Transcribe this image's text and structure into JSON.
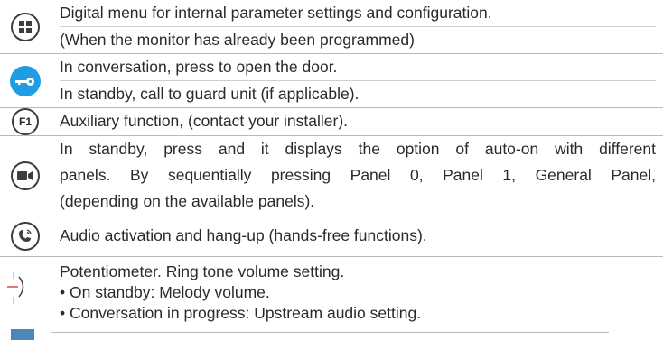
{
  "rows": [
    {
      "icon": "menu-grid-icon",
      "lines": [
        "Digital menu for internal parameter settings and configuration.",
        "(When the monitor has already been programmed)"
      ]
    },
    {
      "icon": "door-key-icon",
      "lines": [
        "In conversation, press to open the door.",
        "In standby, call to guard unit (if applicable)."
      ]
    },
    {
      "icon": "f1-icon",
      "icon_text": "F1",
      "lines": [
        "Auxiliary function, (contact your installer)."
      ]
    },
    {
      "icon": "camera-icon",
      "lines": [
        "In standby, press and it displays the option of auto-on with different",
        "panels. By sequentially pressing Panel 0, Panel 1, General Panel,",
        "(depending on the available panels)."
      ]
    },
    {
      "icon": "hands-free-icon",
      "lines": [
        "Audio activation and hang-up (hands-free functions)."
      ]
    },
    {
      "icon": "potentiometer-icon",
      "lines": [
        "Potentiometer. Ring tone volume setting.",
        "• On standby: Melody volume.",
        "• Conversation in progress: Upstream audio setting."
      ]
    }
  ],
  "colors": {
    "accent_blue": "#1e9de2",
    "rule": "#b9b9b9",
    "text": "#2a2a2a"
  }
}
